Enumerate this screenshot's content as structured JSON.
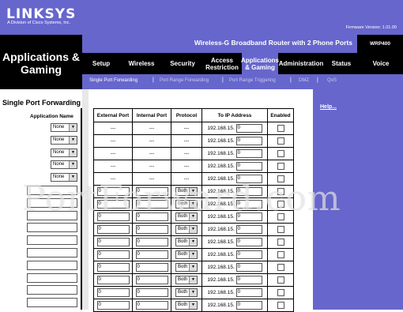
{
  "brand": {
    "name": "LINKSYS",
    "tagline": "A Division of Cisco Systems, Inc.",
    "firmware": "Firmware Version: 1.01.00"
  },
  "product": {
    "name": "Wireless-G Broadband Router with 2 Phone Ports",
    "model": "WRP400"
  },
  "section_title": "Applications & Gaming",
  "nav": {
    "tabs": [
      {
        "label": "Setup"
      },
      {
        "label": "Wireless"
      },
      {
        "label": "Security"
      },
      {
        "label": "Access Restriction"
      },
      {
        "label": "Applications & Gaming"
      },
      {
        "label": "Administration"
      },
      {
        "label": "Status"
      },
      {
        "label": "Voice"
      }
    ]
  },
  "subnav": {
    "items": [
      {
        "label": "Single Port Forwarding"
      },
      {
        "label": "Port Range Forwarding"
      },
      {
        "label": "Port Range Triggering"
      },
      {
        "label": "DMZ"
      },
      {
        "label": "QoS"
      }
    ],
    "separator": "|"
  },
  "page": {
    "title": "Single Port Forwarding",
    "help_link": "Help..."
  },
  "table": {
    "headers": {
      "app": "Application Name",
      "ext": "External Port",
      "int": "Internal Port",
      "proto": "Protocol",
      "ip": "To IP Address",
      "enabled": "Enabled"
    },
    "ip_prefix": "192.168.15.",
    "preset_rows": [
      {
        "app": "None",
        "ext": "---",
        "int": "---",
        "proto": "---",
        "ip": "0"
      },
      {
        "app": "None",
        "ext": "---",
        "int": "---",
        "proto": "---",
        "ip": "0"
      },
      {
        "app": "None",
        "ext": "---",
        "int": "---",
        "proto": "---",
        "ip": "0"
      },
      {
        "app": "None",
        "ext": "---",
        "int": "---",
        "proto": "---",
        "ip": "0"
      },
      {
        "app": "None",
        "ext": "---",
        "int": "---",
        "proto": "---",
        "ip": "0"
      }
    ],
    "custom_rows": [
      {
        "ext": "0",
        "int": "0",
        "proto": "Both",
        "ip": "0"
      },
      {
        "ext": "0",
        "int": "0",
        "proto": "Both",
        "ip": "0"
      },
      {
        "ext": "0",
        "int": "0",
        "proto": "Both",
        "ip": "0"
      },
      {
        "ext": "0",
        "int": "0",
        "proto": "Both",
        "ip": "0"
      },
      {
        "ext": "0",
        "int": "0",
        "proto": "Both",
        "ip": "0"
      },
      {
        "ext": "0",
        "int": "0",
        "proto": "Both",
        "ip": "0"
      },
      {
        "ext": "0",
        "int": "0",
        "proto": "Both",
        "ip": "0"
      },
      {
        "ext": "0",
        "int": "0",
        "proto": "Both",
        "ip": "0"
      },
      {
        "ext": "0",
        "int": "0",
        "proto": "Both",
        "ip": "0"
      },
      {
        "ext": "0",
        "int": "0",
        "proto": "Both",
        "ip": "0"
      }
    ]
  },
  "watermark": "PortForward.com",
  "colors": {
    "accent": "#6666cc",
    "dark": "#000000"
  }
}
